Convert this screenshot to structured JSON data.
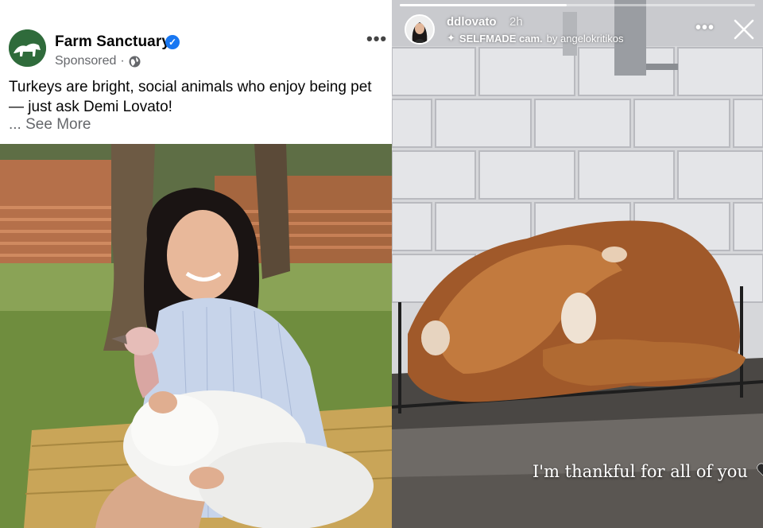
{
  "facebook_ad": {
    "page_name": "Farm Sanctuary",
    "sponsored_label": "Sponsored",
    "separator": "·",
    "caption": "Turkeys are bright, social animals who enjoy being pet — just ask Demi Lovato!",
    "see_more": "... See More",
    "more_icon": "more-options-icon",
    "verified_icon": "verified-badge-icon",
    "audience_icon": "globe-icon"
  },
  "instagram_story": {
    "username": "ddlovato",
    "time_ago": "2h",
    "effect_name": "SELFMADE cam.",
    "effect_by": "by angelokritikos",
    "caption": "I'm thankful for all of you",
    "progress": 0.47,
    "more_icon": "more-options-icon",
    "close_icon": "close-icon",
    "heart_color": "#2a2a2a"
  },
  "colors": {
    "fb_verified": "#1877f2",
    "fb_secondary_text": "#65676b",
    "fb_primary_text": "#050505"
  }
}
